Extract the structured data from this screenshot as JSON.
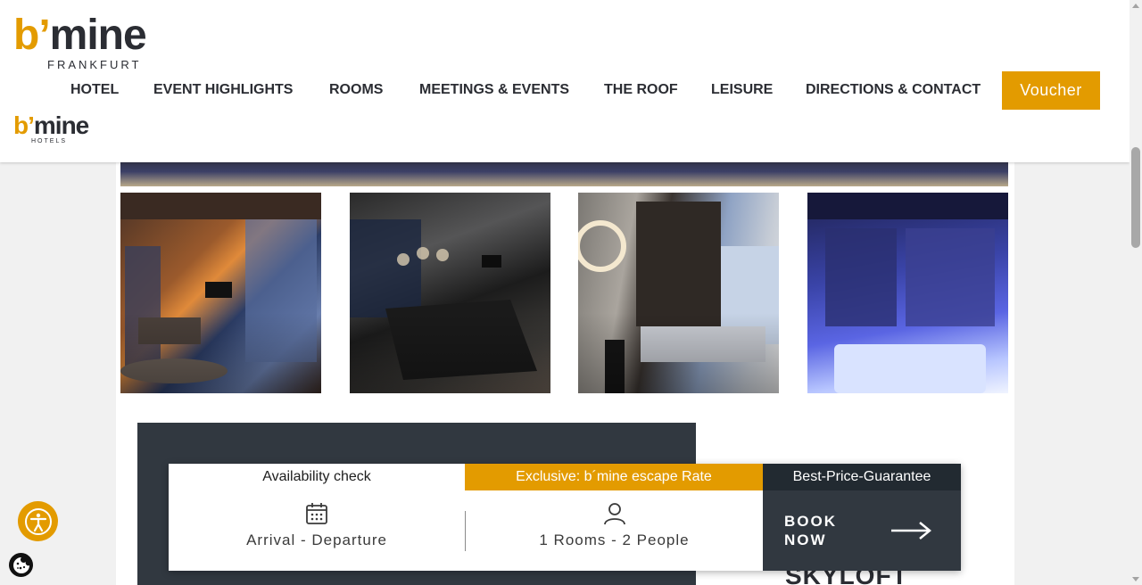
{
  "brand": {
    "logo_word_b": "b’",
    "logo_word_rest": "mine",
    "logo_sub": "FRANKFURT",
    "group_logo_word_b": "b’",
    "group_logo_word_rest": "mine",
    "group_logo_sub": "HOTELS",
    "accent": "#e39b00",
    "dark": "#313840"
  },
  "nav": {
    "items": [
      "HOTEL",
      "EVENT HIGHLIGHTS",
      "ROOMS",
      "MEETINGS & EVENTS",
      "THE ROOF",
      "LEISURE",
      "DIRECTIONS & CONTACT"
    ],
    "voucher_label": "Voucher"
  },
  "gallery": {
    "images": [
      "living-room-photo",
      "dining-room-photo",
      "bedroom-photo",
      "whirlpool-photo"
    ]
  },
  "booking": {
    "tabs": {
      "availability": "Availability check",
      "exclusive": "Exclusive: b´mine escape Rate",
      "best_price": "Best-Price-Guarantee"
    },
    "dates_label": "Arrival - Departure",
    "guests_label": "1 Rooms - 2 People",
    "book_now_line1": "BOOK",
    "book_now_line2": "NOW"
  },
  "section": {
    "heading_peek": "SKYLOFT"
  },
  "icons": [
    "calendar-icon",
    "person-icon",
    "arrow-right-icon",
    "accessibility-icon",
    "cookie-icon"
  ]
}
